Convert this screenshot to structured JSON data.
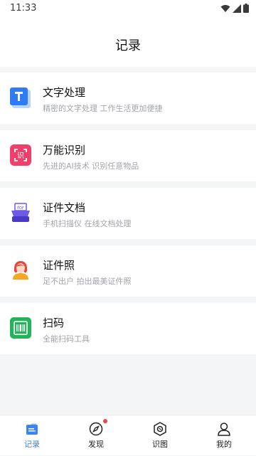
{
  "status": {
    "time": "11:33"
  },
  "header": {
    "title": "记录"
  },
  "cards": [
    {
      "title": "文字处理",
      "subtitle": "精密的文字处理  工作生活更加便捷",
      "icon": "text-recognition-icon"
    },
    {
      "title": "万能识别",
      "subtitle": "先进的AI技术 识别任意物品",
      "icon": "universal-recognition-icon"
    },
    {
      "title": "证件文档",
      "subtitle": "手机扫描仪 在线文档处理",
      "icon": "document-scanner-icon"
    },
    {
      "title": "证件照",
      "subtitle": "足不出户  拍出最美证件照",
      "icon": "id-photo-icon"
    },
    {
      "title": "扫码",
      "subtitle": "全能扫码工具",
      "icon": "barcode-scan-icon"
    }
  ],
  "tabbar": {
    "items": [
      {
        "label": "记录",
        "icon": "records-icon",
        "active": true
      },
      {
        "label": "发现",
        "icon": "compass-icon",
        "badge": true
      },
      {
        "label": "识图",
        "icon": "image-recognition-icon"
      },
      {
        "label": "我的",
        "icon": "profile-icon"
      }
    ]
  },
  "colors": {
    "accent": "#3b82f6",
    "badge": "#ef4444",
    "background": "#f4f5f7"
  }
}
